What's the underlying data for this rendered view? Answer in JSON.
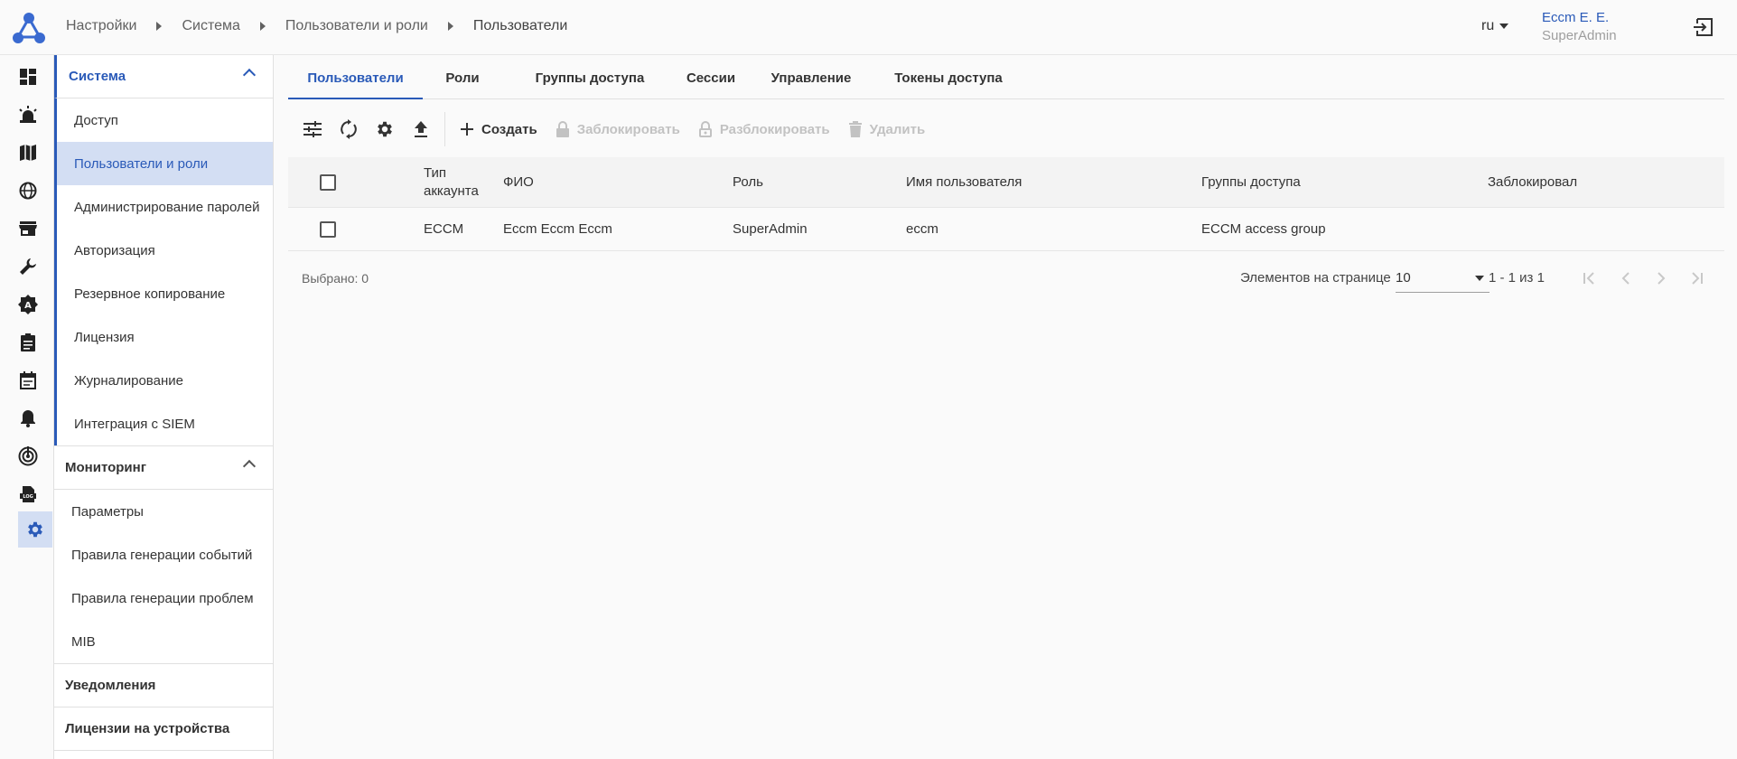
{
  "header": {
    "breadcrumbs": [
      "Настройки",
      "Система",
      "Пользователи и роли",
      "Пользователи"
    ],
    "language": "ru",
    "user_name": "Eccm E. E.",
    "user_role": "SuperAdmin",
    "accent_color": "#2a5ab8"
  },
  "rail": {
    "icons": [
      "dashboard-icon",
      "alarm-icon",
      "map-icon",
      "globe-icon",
      "store-icon",
      "wrench-icon",
      "auto-icon",
      "clipboard-icon",
      "calendar-icon",
      "bell-icon",
      "radar-icon",
      "log-icon",
      "settings-icon"
    ],
    "active": "settings-icon"
  },
  "subnav": {
    "system": {
      "title": "Система",
      "items": [
        "Доступ",
        "Пользователи и роли",
        "Администрирование паролей",
        "Авторизация",
        "Резервное копирование",
        "Лицензия",
        "Журналирование",
        "Интеграция с SIEM"
      ],
      "active_item": "Пользователи и роли"
    },
    "monitoring": {
      "title": "Мониторинг",
      "items": [
        "Параметры",
        "Правила генерации событий",
        "Правила генерации проблем",
        "MIB"
      ]
    },
    "notifications": {
      "title": "Уведомления"
    },
    "device_licenses": {
      "title": "Лицензии на устройства"
    }
  },
  "tabs": [
    "Пользователи",
    "Роли",
    "Группы доступа",
    "Сессии",
    "Управление",
    "Токены доступа"
  ],
  "active_tab": "Пользователи",
  "toolbar": {
    "icons": [
      "filter-settings-icon",
      "refresh-icon",
      "gear-icon",
      "upload-icon"
    ],
    "create": "Создать",
    "block": "Заблокировать",
    "unblock": "Разблокировать",
    "delete": "Удалить"
  },
  "table": {
    "columns": {
      "account_type_1": "Тип",
      "account_type_2": "аккаунта",
      "full_name": "ФИО",
      "role": "Роль",
      "username": "Имя пользователя",
      "access_groups": "Группы доступа",
      "blocked_by": "Заблокировал"
    },
    "rows": [
      {
        "account_type": "ECCM",
        "full_name": "Eccm Eccm Eccm",
        "role": "SuperAdmin",
        "username": "eccm",
        "access_groups": "ECCM access group",
        "blocked_by": ""
      }
    ]
  },
  "footer": {
    "selected": "Выбрано: 0",
    "per_page_label": "Элементов на странице",
    "per_page": "10",
    "range": "1 - 1 из 1"
  }
}
